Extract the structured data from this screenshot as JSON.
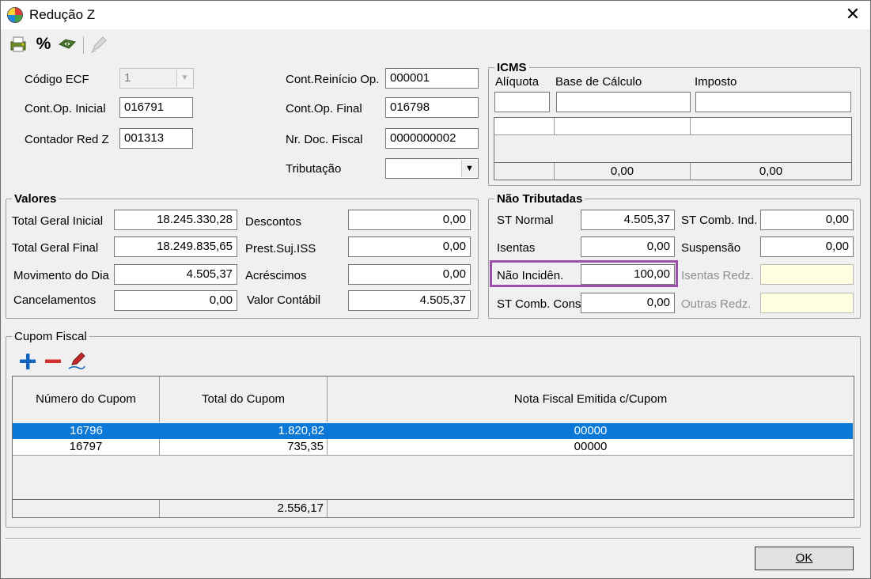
{
  "window": {
    "title": "Redução Z",
    "close_glyph": "✕"
  },
  "toolbar": {
    "icons": [
      "print-icon",
      "percent-icon",
      "view-icon",
      "edit-icon"
    ],
    "percent_glyph": "%"
  },
  "header": {
    "codigo_ecf_label": "Código ECF",
    "codigo_ecf_value": "1",
    "cont_op_inicial_label": "Cont.Op. Inicial",
    "cont_op_inicial_value": "016791",
    "contador_red_z_label": "Contador Red Z",
    "contador_red_z_value": "001313",
    "cont_reinicio_label": "Cont.Reinício Op.",
    "cont_reinicio_value": "000001",
    "cont_op_final_label": "Cont.Op. Final",
    "cont_op_final_value": "016798",
    "nr_doc_fiscal_label": "Nr. Doc. Fiscal",
    "nr_doc_fiscal_value": "0000000002",
    "tributacao_label": "Tributação",
    "tributacao_value": ""
  },
  "icms": {
    "title": "ICMS",
    "aliquota_label": "Alíquota",
    "base_label": "Base de Cálculo",
    "imposto_label": "Imposto",
    "aliquota_value": "",
    "base_value": "",
    "imposto_value": "",
    "total_base": "0,00",
    "total_imposto": "0,00"
  },
  "valores": {
    "title": "Valores",
    "total_geral_inicial_label": "Total Geral Inicial",
    "total_geral_inicial_value": "18.245.330,28",
    "total_geral_final_label": "Total Geral Final",
    "total_geral_final_value": "18.249.835,65",
    "movimento_label": "Movimento do Dia",
    "movimento_value": "4.505,37",
    "cancelamentos_label": "Cancelamentos",
    "cancelamentos_value": "0,00",
    "descontos_label": "Descontos",
    "descontos_value": "0,00",
    "prest_iss_label": "Prest.Suj.ISS",
    "prest_iss_value": "0,00",
    "acrescimos_label": "Acréscimos",
    "acrescimos_value": "0,00",
    "valor_contabil_label": "Valor Contábil",
    "valor_contabil_value": "4.505,37"
  },
  "nao_tributadas": {
    "title": "Não Tributadas",
    "st_normal_label": "ST Normal",
    "st_normal_value": "4.505,37",
    "isentas_label": "Isentas",
    "isentas_value": "0,00",
    "nao_incid_label": "Não Incidên.",
    "nao_incid_value": "100,00",
    "st_comb_cons_label": "ST Comb. Cons",
    "st_comb_cons_value": "0,00",
    "st_comb_ind_label": "ST Comb. Ind.",
    "st_comb_ind_value": "0,00",
    "suspensao_label": "Suspensão",
    "suspensao_value": "0,00",
    "isentas_redz_label": "Isentas Redz.",
    "isentas_redz_value": "",
    "outras_redz_label": "Outras Redz.",
    "outras_redz_value": ""
  },
  "cupom": {
    "title": "Cupom Fiscal",
    "columns": [
      "Número do Cupom",
      "Total do Cupom",
      "Nota Fiscal Emitida c/Cupom"
    ],
    "rows": [
      {
        "numero": "16796",
        "total": "1.820,82",
        "nota": "00000",
        "selected": true
      },
      {
        "numero": "16797",
        "total": "735,35",
        "nota": "00000",
        "selected": false
      }
    ],
    "footer_total": "2.556,17"
  },
  "buttons": {
    "ok_label": "OK"
  },
  "colors": {
    "selection": "#0a78d7",
    "highlight_border": "#9c4fa8",
    "readonly_yellow": "#ffffe1"
  }
}
